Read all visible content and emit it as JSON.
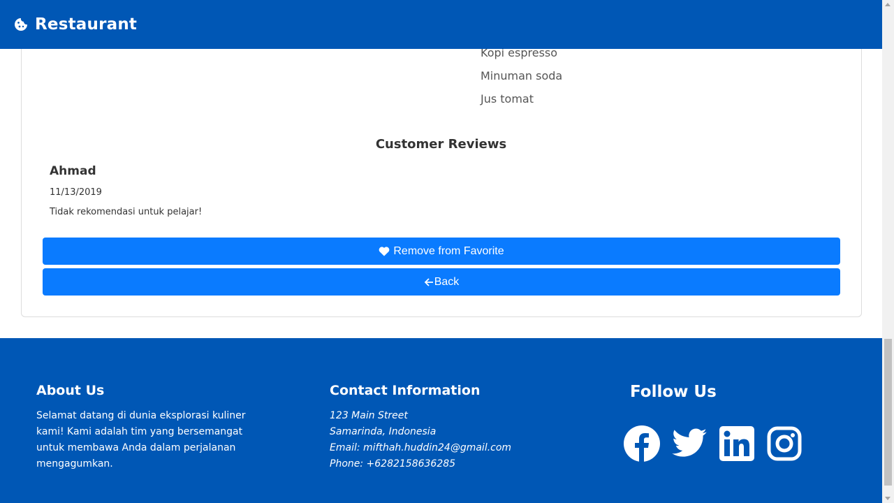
{
  "header": {
    "brand_icon": "cookie-icon",
    "title": "Restaurant"
  },
  "menu": {
    "drinks": [
      "Kopi espresso",
      "Minuman soda",
      "Jus tomat"
    ]
  },
  "reviews": {
    "title": "Customer Reviews",
    "items": [
      {
        "name": "Ahmad",
        "date": "11/13/2019",
        "text": "Tidak rekomendasi untuk pelajar!"
      }
    ]
  },
  "actions": {
    "favorite_label": "Remove from Favorite",
    "favorite_icon": "heart-icon",
    "back_label": "Back",
    "back_icon": "arrow-left-icon"
  },
  "footer": {
    "about": {
      "title": "About Us",
      "text": "Selamat datang di dunia eksplorasi kuliner kami! Kami adalah tim yang bersemangat untuk membawa Anda dalam perjalanan mengagumkan."
    },
    "contact": {
      "title": "Contact Information",
      "street": "123 Main Street",
      "city": "Samarinda, Indonesia",
      "email": "Email: mifthah.huddin24@gmail.com",
      "phone": "Phone: +6282158636285"
    },
    "follow": {
      "title": "Follow Us",
      "icons": [
        "facebook-icon",
        "twitter-icon",
        "linkedin-icon",
        "instagram-icon"
      ]
    }
  },
  "colors": {
    "brand": "#0057b5",
    "button": "#0a7bff"
  }
}
